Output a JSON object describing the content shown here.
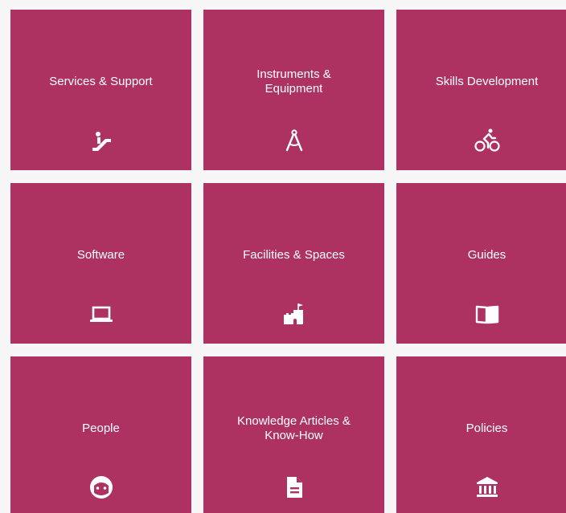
{
  "tiles": [
    {
      "label": "Services & Support",
      "icon": "escalator-icon"
    },
    {
      "label": "Instruments &\nEquipment",
      "icon": "compass-icon"
    },
    {
      "label": "Skills Development",
      "icon": "cyclist-icon"
    },
    {
      "label": "Software",
      "icon": "laptop-icon"
    },
    {
      "label": "Facilities & Spaces",
      "icon": "castle-icon"
    },
    {
      "label": "Guides",
      "icon": "open-book-icon"
    },
    {
      "label": "People",
      "icon": "face-icon"
    },
    {
      "label": "Knowledge Articles &\nKnow-How",
      "icon": "document-icon"
    },
    {
      "label": "Policies",
      "icon": "institution-icon"
    }
  ],
  "colors": {
    "tile": "#ad3262",
    "text": "#ffffff",
    "background": "#f6f6f6"
  }
}
